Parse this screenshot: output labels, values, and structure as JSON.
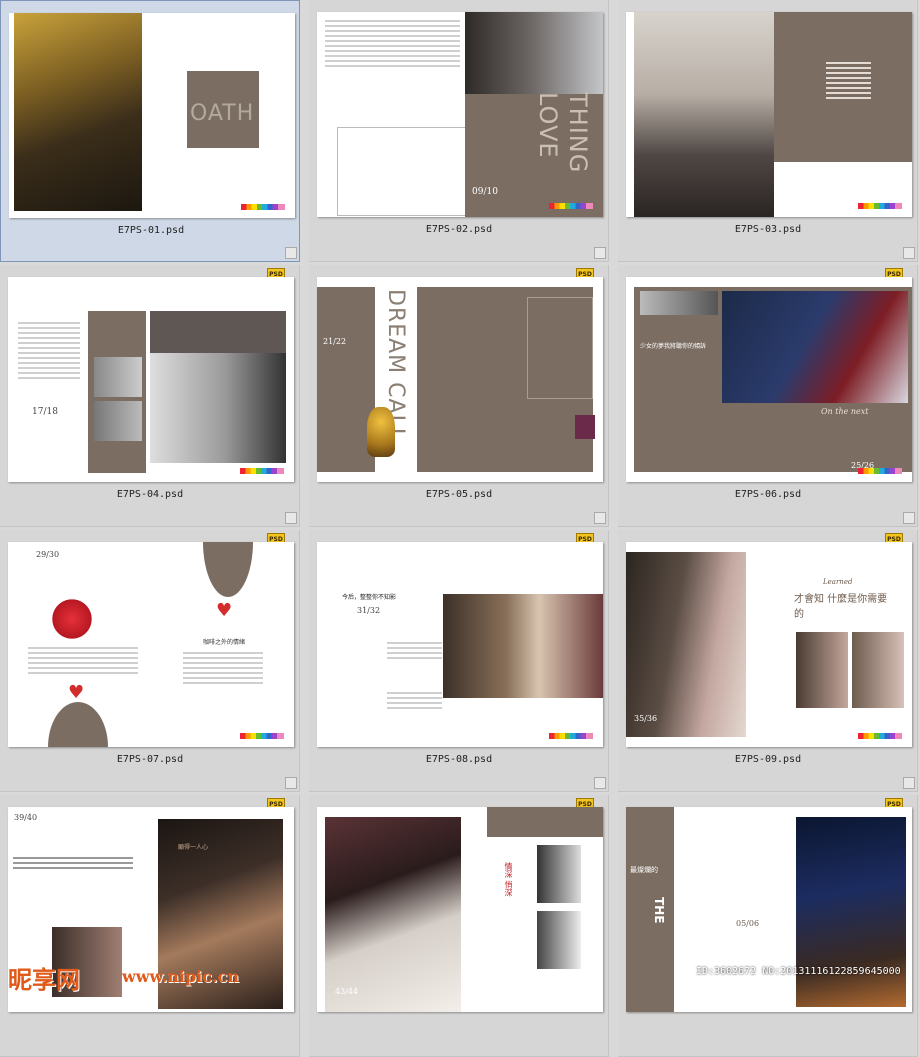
{
  "files": [
    {
      "name": "E7PS-01.psd",
      "heading": "OATH"
    },
    {
      "name": "E7PS-02.psd",
      "heading": "THING LOVE"
    },
    {
      "name": "E7PS-03.psd",
      "heading": ""
    },
    {
      "name": "E7PS-04.psd",
      "heading": ""
    },
    {
      "name": "E7PS-05.psd",
      "heading": "DREAM CALL"
    },
    {
      "name": "E7PS-06.psd",
      "heading": "少女的夢我將聽你的傾訴"
    },
    {
      "name": "E7PS-07.psd",
      "heading": "咖啡之外的情緒"
    },
    {
      "name": "E7PS-08.psd",
      "heading": "今后，整整你不知影"
    },
    {
      "name": "E7PS-09.psd",
      "heading": "才會知 什麼是你需要的"
    },
    {
      "name": "E7PS-10.psd",
      "heading": "願得一人心"
    },
    {
      "name": "E7PS-11.psd",
      "heading": "情深 悄深"
    },
    {
      "name": "E7PS-12.psd",
      "heading": "最燦爛的"
    }
  ],
  "page_numbers": {
    "p2": "09/10",
    "p4": "17/18",
    "p5": "21/22",
    "p6": "25/26",
    "p7": "29/30",
    "p8": "31/32",
    "p9": "35/36",
    "p10": "39/40",
    "p11": "43/44",
    "p12": "05/06"
  },
  "extra_text": {
    "on_the_next": "On the next",
    "learned": "Learned",
    "the": "THE"
  },
  "badge_label": "PSD",
  "watermark": {
    "logo": "昵享网",
    "url": "www.nipic.cn",
    "id": "ID:3602672 NO:20131116122859645000"
  }
}
